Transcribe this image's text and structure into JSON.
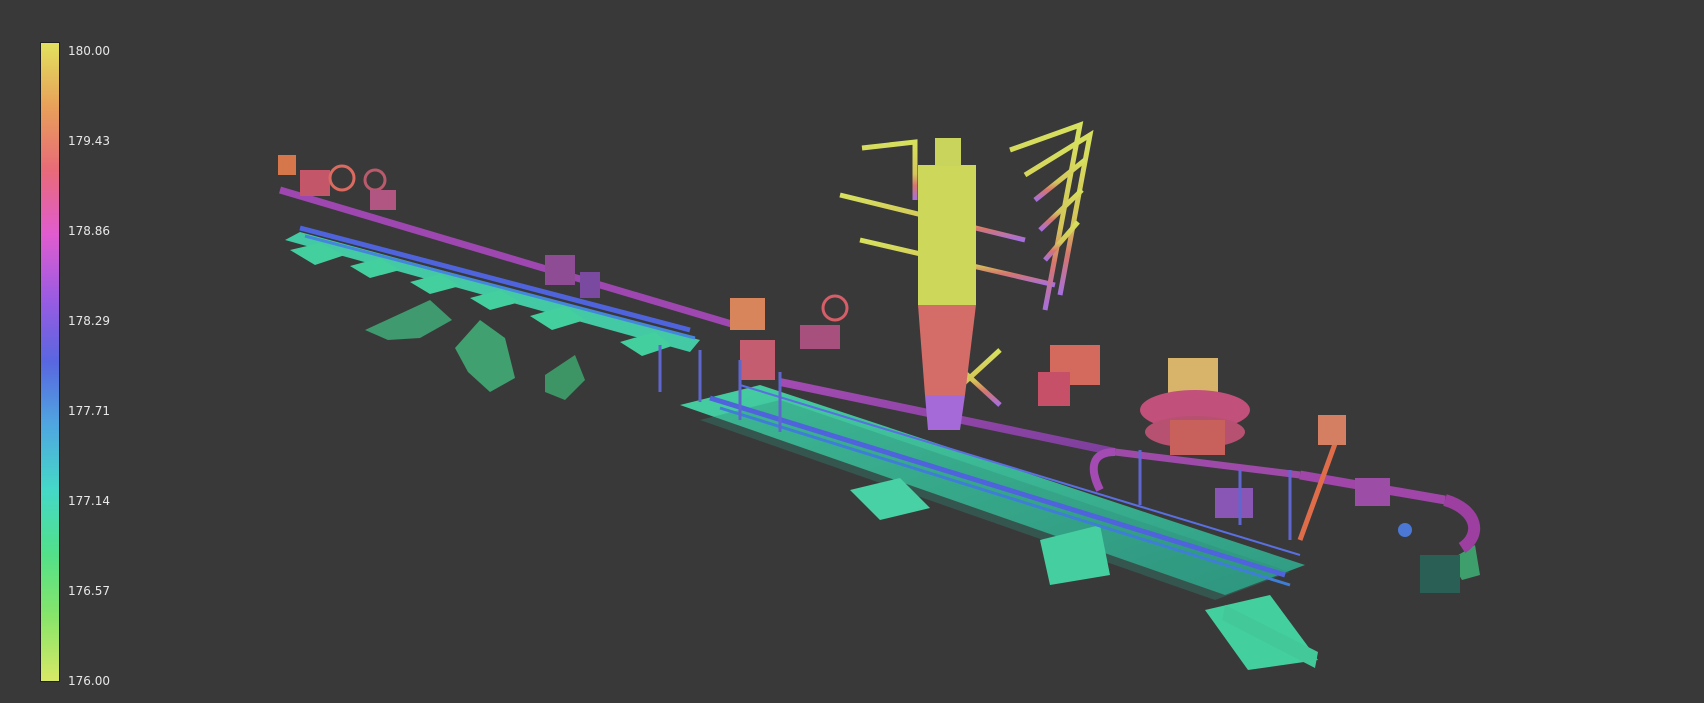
{
  "viewer": {
    "background": "#393939"
  },
  "scalar_bar": {
    "min": 176.0,
    "max": 180.0,
    "labels": [
      "180.00",
      "179.43",
      "178.86",
      "178.29",
      "177.71",
      "177.14",
      "176.57",
      "176.00"
    ],
    "colormap": [
      "#e2e25e",
      "#e8a05a",
      "#e86a78",
      "#e05ccf",
      "#9b5be2",
      "#5966e0",
      "#4fa7e0",
      "#45d8c8",
      "#52e08a",
      "#88e56a",
      "#d8e866"
    ]
  },
  "model": {
    "name": "pipeline-point-cloud",
    "colors": {
      "tower": "#c6d34a",
      "pipe": "#9b3fa7",
      "pipe_low": "#4f57d8",
      "equipment": "#d05a5a",
      "base": "#40c99a",
      "base_shadow": "#2c8d73",
      "terrain": "#3f9f72"
    }
  }
}
